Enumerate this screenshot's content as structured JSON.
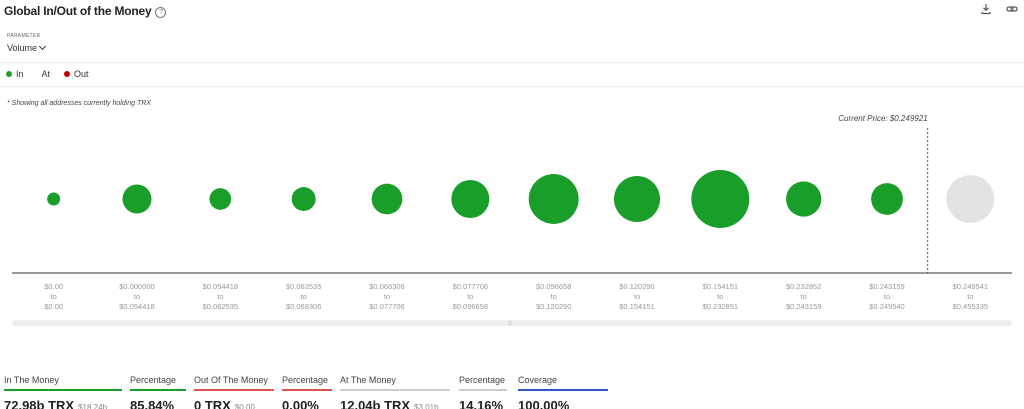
{
  "header": {
    "title": "Global In/Out of the Money",
    "help_icon": "question-circle-icon",
    "download_icon": "download-icon",
    "link_icon": "link-icon"
  },
  "parameter": {
    "label": "PARAMETER",
    "value": "Volume"
  },
  "legend": [
    {
      "label": "In",
      "color": "#1a9e2a"
    },
    {
      "label": "At",
      "color": "#cccccc"
    },
    {
      "label": "Out",
      "color": "#c00000"
    }
  ],
  "note": "* Showing all addresses currently holding TRX",
  "chart_data": {
    "type": "bubble",
    "current_price_label": "Current Price: $0.249921",
    "current_price": 0.249921,
    "categories": [
      {
        "from": "$0.00",
        "to": "$0.00"
      },
      {
        "from": "$0.000000",
        "to": "$0.054418"
      },
      {
        "from": "$0.054418",
        "to": "$0.062535"
      },
      {
        "from": "$0.062535",
        "to": "$0.068306"
      },
      {
        "from": "$0.068306",
        "to": "$0.077706"
      },
      {
        "from": "$0.077706",
        "to": "$0.096658"
      },
      {
        "from": "$0.096658",
        "to": "$0.120290"
      },
      {
        "from": "$0.120290",
        "to": "$0.154151"
      },
      {
        "from": "$0.154151",
        "to": "$0.232851"
      },
      {
        "from": "$0.232852",
        "to": "$0.243159"
      },
      {
        "from": "$0.243159",
        "to": "$0.249540"
      },
      {
        "from": "$0.249541",
        "to": "$0.455335"
      }
    ],
    "range_connector": "to",
    "status": [
      "in",
      "in",
      "in",
      "in",
      "in",
      "in",
      "in",
      "in",
      "in",
      "in",
      "in",
      "at"
    ],
    "relative_volume": [
      0.05,
      0.25,
      0.14,
      0.17,
      0.28,
      0.43,
      0.74,
      0.63,
      1.0,
      0.37,
      0.3,
      0.68
    ]
  },
  "stats": [
    {
      "label": "In The Money",
      "value": "72.98b TRX",
      "sub": "$18.24b",
      "color": "#1a9e2a"
    },
    {
      "label": "Percentage",
      "value": "85.84%",
      "color": "#1a9e2a"
    },
    {
      "label": "Out Of The Money",
      "value": "0 TRX",
      "sub": "$0.00",
      "color": "#d9534f"
    },
    {
      "label": "Percentage",
      "value": "0.00%",
      "color": "#d9534f"
    },
    {
      "label": "At The Money",
      "value": "12.04b TRX",
      "sub": "$3.01b",
      "color": "#cccccc"
    },
    {
      "label": "Percentage",
      "value": "14.16%",
      "color": "#cccccc"
    },
    {
      "label": "Coverage",
      "value": "100.00%",
      "color": "#3355cc"
    }
  ]
}
